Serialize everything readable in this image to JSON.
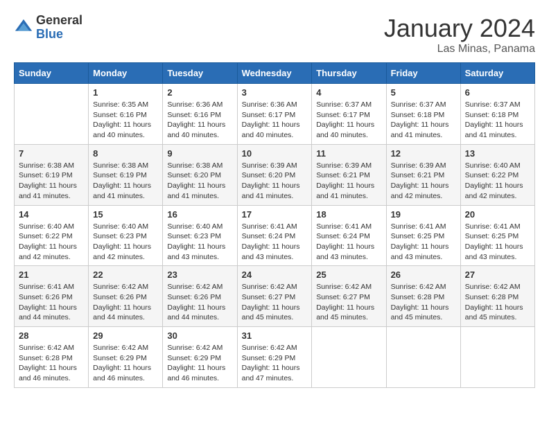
{
  "logo": {
    "general": "General",
    "blue": "Blue"
  },
  "title": "January 2024",
  "location": "Las Minas, Panama",
  "days_of_week": [
    "Sunday",
    "Monday",
    "Tuesday",
    "Wednesday",
    "Thursday",
    "Friday",
    "Saturday"
  ],
  "weeks": [
    [
      {
        "day": "",
        "sunrise": "",
        "sunset": "",
        "daylight": ""
      },
      {
        "day": "1",
        "sunrise": "Sunrise: 6:35 AM",
        "sunset": "Sunset: 6:16 PM",
        "daylight": "Daylight: 11 hours and 40 minutes."
      },
      {
        "day": "2",
        "sunrise": "Sunrise: 6:36 AM",
        "sunset": "Sunset: 6:16 PM",
        "daylight": "Daylight: 11 hours and 40 minutes."
      },
      {
        "day": "3",
        "sunrise": "Sunrise: 6:36 AM",
        "sunset": "Sunset: 6:17 PM",
        "daylight": "Daylight: 11 hours and 40 minutes."
      },
      {
        "day": "4",
        "sunrise": "Sunrise: 6:37 AM",
        "sunset": "Sunset: 6:17 PM",
        "daylight": "Daylight: 11 hours and 40 minutes."
      },
      {
        "day": "5",
        "sunrise": "Sunrise: 6:37 AM",
        "sunset": "Sunset: 6:18 PM",
        "daylight": "Daylight: 11 hours and 41 minutes."
      },
      {
        "day": "6",
        "sunrise": "Sunrise: 6:37 AM",
        "sunset": "Sunset: 6:18 PM",
        "daylight": "Daylight: 11 hours and 41 minutes."
      }
    ],
    [
      {
        "day": "7",
        "sunrise": "Sunrise: 6:38 AM",
        "sunset": "Sunset: 6:19 PM",
        "daylight": "Daylight: 11 hours and 41 minutes."
      },
      {
        "day": "8",
        "sunrise": "Sunrise: 6:38 AM",
        "sunset": "Sunset: 6:19 PM",
        "daylight": "Daylight: 11 hours and 41 minutes."
      },
      {
        "day": "9",
        "sunrise": "Sunrise: 6:38 AM",
        "sunset": "Sunset: 6:20 PM",
        "daylight": "Daylight: 11 hours and 41 minutes."
      },
      {
        "day": "10",
        "sunrise": "Sunrise: 6:39 AM",
        "sunset": "Sunset: 6:20 PM",
        "daylight": "Daylight: 11 hours and 41 minutes."
      },
      {
        "day": "11",
        "sunrise": "Sunrise: 6:39 AM",
        "sunset": "Sunset: 6:21 PM",
        "daylight": "Daylight: 11 hours and 41 minutes."
      },
      {
        "day": "12",
        "sunrise": "Sunrise: 6:39 AM",
        "sunset": "Sunset: 6:21 PM",
        "daylight": "Daylight: 11 hours and 42 minutes."
      },
      {
        "day": "13",
        "sunrise": "Sunrise: 6:40 AM",
        "sunset": "Sunset: 6:22 PM",
        "daylight": "Daylight: 11 hours and 42 minutes."
      }
    ],
    [
      {
        "day": "14",
        "sunrise": "Sunrise: 6:40 AM",
        "sunset": "Sunset: 6:22 PM",
        "daylight": "Daylight: 11 hours and 42 minutes."
      },
      {
        "day": "15",
        "sunrise": "Sunrise: 6:40 AM",
        "sunset": "Sunset: 6:23 PM",
        "daylight": "Daylight: 11 hours and 42 minutes."
      },
      {
        "day": "16",
        "sunrise": "Sunrise: 6:40 AM",
        "sunset": "Sunset: 6:23 PM",
        "daylight": "Daylight: 11 hours and 43 minutes."
      },
      {
        "day": "17",
        "sunrise": "Sunrise: 6:41 AM",
        "sunset": "Sunset: 6:24 PM",
        "daylight": "Daylight: 11 hours and 43 minutes."
      },
      {
        "day": "18",
        "sunrise": "Sunrise: 6:41 AM",
        "sunset": "Sunset: 6:24 PM",
        "daylight": "Daylight: 11 hours and 43 minutes."
      },
      {
        "day": "19",
        "sunrise": "Sunrise: 6:41 AM",
        "sunset": "Sunset: 6:25 PM",
        "daylight": "Daylight: 11 hours and 43 minutes."
      },
      {
        "day": "20",
        "sunrise": "Sunrise: 6:41 AM",
        "sunset": "Sunset: 6:25 PM",
        "daylight": "Daylight: 11 hours and 43 minutes."
      }
    ],
    [
      {
        "day": "21",
        "sunrise": "Sunrise: 6:41 AM",
        "sunset": "Sunset: 6:26 PM",
        "daylight": "Daylight: 11 hours and 44 minutes."
      },
      {
        "day": "22",
        "sunrise": "Sunrise: 6:42 AM",
        "sunset": "Sunset: 6:26 PM",
        "daylight": "Daylight: 11 hours and 44 minutes."
      },
      {
        "day": "23",
        "sunrise": "Sunrise: 6:42 AM",
        "sunset": "Sunset: 6:26 PM",
        "daylight": "Daylight: 11 hours and 44 minutes."
      },
      {
        "day": "24",
        "sunrise": "Sunrise: 6:42 AM",
        "sunset": "Sunset: 6:27 PM",
        "daylight": "Daylight: 11 hours and 45 minutes."
      },
      {
        "day": "25",
        "sunrise": "Sunrise: 6:42 AM",
        "sunset": "Sunset: 6:27 PM",
        "daylight": "Daylight: 11 hours and 45 minutes."
      },
      {
        "day": "26",
        "sunrise": "Sunrise: 6:42 AM",
        "sunset": "Sunset: 6:28 PM",
        "daylight": "Daylight: 11 hours and 45 minutes."
      },
      {
        "day": "27",
        "sunrise": "Sunrise: 6:42 AM",
        "sunset": "Sunset: 6:28 PM",
        "daylight": "Daylight: 11 hours and 45 minutes."
      }
    ],
    [
      {
        "day": "28",
        "sunrise": "Sunrise: 6:42 AM",
        "sunset": "Sunset: 6:28 PM",
        "daylight": "Daylight: 11 hours and 46 minutes."
      },
      {
        "day": "29",
        "sunrise": "Sunrise: 6:42 AM",
        "sunset": "Sunset: 6:29 PM",
        "daylight": "Daylight: 11 hours and 46 minutes."
      },
      {
        "day": "30",
        "sunrise": "Sunrise: 6:42 AM",
        "sunset": "Sunset: 6:29 PM",
        "daylight": "Daylight: 11 hours and 46 minutes."
      },
      {
        "day": "31",
        "sunrise": "Sunrise: 6:42 AM",
        "sunset": "Sunset: 6:29 PM",
        "daylight": "Daylight: 11 hours and 47 minutes."
      },
      {
        "day": "",
        "sunrise": "",
        "sunset": "",
        "daylight": ""
      },
      {
        "day": "",
        "sunrise": "",
        "sunset": "",
        "daylight": ""
      },
      {
        "day": "",
        "sunrise": "",
        "sunset": "",
        "daylight": ""
      }
    ]
  ]
}
